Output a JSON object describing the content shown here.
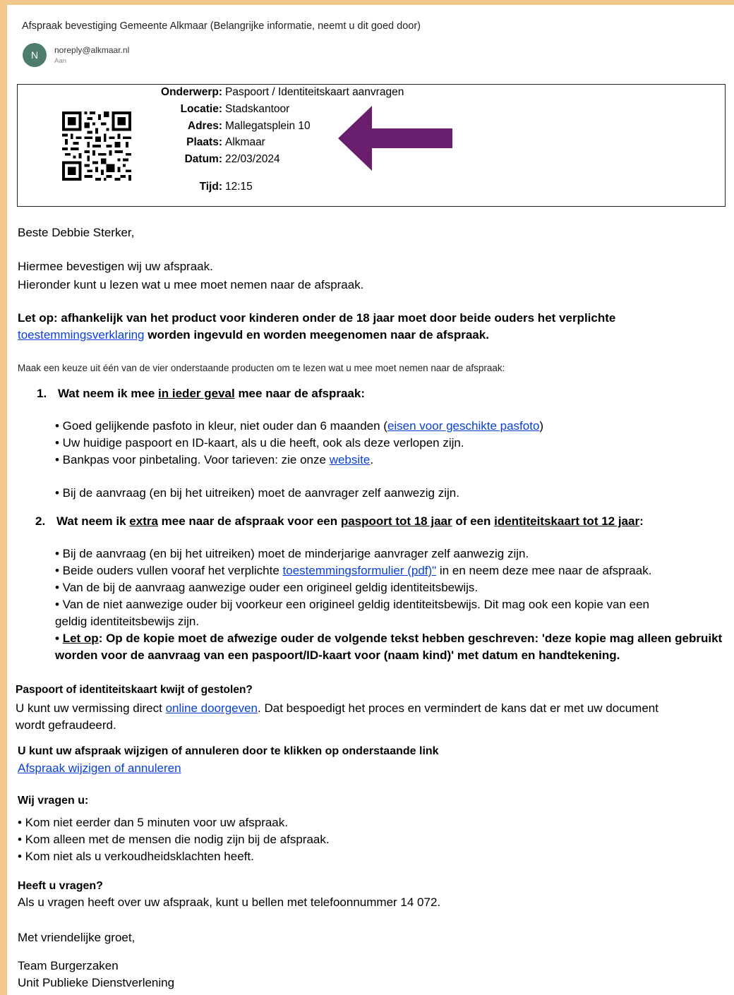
{
  "email": {
    "subject": "Afspraak bevestiging Gemeente Alkmaar (Belangrijke informatie, neemt u dit goed door)",
    "avatar_initial": "N",
    "sender": "noreply@alkmaar.nl",
    "recipient_label": "Aan"
  },
  "appointment": {
    "rows": [
      {
        "label": "Onderwerp:",
        "value": "Paspoort / Identiteitskaart aanvragen"
      },
      {
        "label": "Locatie:",
        "value": "Stadskantoor"
      },
      {
        "label": "Adres:",
        "value": "Mallegatsplein 10"
      },
      {
        "label": "Plaats:",
        "value": "Alkmaar"
      },
      {
        "label": "Datum:",
        "value": "22/03/2024"
      },
      {
        "label": "Tijd:",
        "value": "12:15"
      }
    ],
    "arrow_color": "#6a1f6e"
  },
  "body": {
    "greeting": "Beste Debbie Sterker,",
    "intro1": "Hiermee bevestigen wij uw afspraak.",
    "intro2": "Hieronder kunt u lezen wat u mee moet nemen naar de afspraak.",
    "notice_line1": "Let op: afhankelijk van het product voor kinderen onder de 18 jaar moet door beide ouders het verplichte",
    "notice_link": "toestemmingsverklaring",
    "notice_rest": " worden ingevuld en worden meegenomen naar de afspraak.",
    "choose_text": "Maak een keuze uit één van de vier onderstaande producten om te lezen wat u mee moet nemen naar de afspraak:",
    "s1": {
      "num": "1.",
      "head_a": "Wat neem ik mee ",
      "head_u": "in ieder geval",
      "head_b": " mee naar de afspraak:",
      "b1_pre": "• Goed gelijkende pasfoto in kleur, niet ouder dan 6 maanden (",
      "b1_link": "eisen voor geschikte pasfoto",
      "b1_post": ")",
      "b2": "• Uw huidige paspoort en ID-kaart, als u die heeft, ook als deze verlopen zijn.",
      "b3_pre": "• Bankpas voor pinbetaling. Voor tarieven: zie onze ",
      "b3_link": "website",
      "b3_post": ".",
      "b4": "• Bij de aanvraag (en bij het uitreiken) moet de aanvrager zelf aanwezig zijn."
    },
    "s2": {
      "num": "2.",
      "head_a": "Wat neem ik ",
      "head_u1": "extra",
      "head_b": " mee naar de afspraak voor een ",
      "head_u2": "paspoort tot 18 jaar",
      "head_c": " of een ",
      "head_u3": "identiteitskaart tot 12 jaar",
      "head_d": ":",
      "b1": "• Bij de aanvraag (en bij het uitreiken) moet de minderjarige aanvrager zelf aanwezig zijn.",
      "b2_pre": "• Beide ouders vullen vooraf het verplichte ",
      "b2_link": "toestemmingsformulier (pdf)\"",
      "b2_post": " in en neem deze mee naar de afspraak.",
      "b3": "• Van de bij de aanvraag aanwezige ouder een origineel geldig identiteitsbewijs.",
      "b4a": "• Van de niet aanwezige ouder bij voorkeur een origineel geldig identiteitsbewijs. Dit mag ook een kopie van een",
      "b4b": "geldig identiteitsbewijs zijn.",
      "b5_bullet": "• ",
      "b5_u": "Let op",
      "b5a": ": Op de kopie moet de afwezige ouder de volgende tekst hebben geschreven: 'deze kopie mag alleen gebruikt",
      "b5b": "worden voor de aanvraag van een paspoort/ID-kaart voor (naam kind)' met datum en handtekening."
    },
    "lost": {
      "heading": "Paspoort of identiteitskaart kwijt of gestolen?",
      "pre": "U kunt uw vermissing direct ",
      "link": "online doorgeven",
      "post": ". Dat bespoedigt het proces en vermindert de kans dat er met uw document",
      "line2": "wordt gefraudeerd."
    },
    "change": {
      "heading": "U kunt uw afspraak wijzigen of annuleren door te klikken op onderstaande link",
      "link": "Afspraak wijzigen of annuleren"
    },
    "ask": {
      "heading": "Wij vragen u:",
      "items": [
        "• Kom niet eerder dan 5 minuten voor uw afspraak.",
        "• Kom alleen met de mensen die nodig zijn bij de afspraak.",
        "• Kom niet als u verkoudheidsklachten heeft."
      ]
    },
    "questions": {
      "heading": "Heeft u vragen?",
      "text": "Als u vragen heeft over uw afspraak, kunt u bellen met telefoonnummer 14 072."
    },
    "closing": "Met vriendelijke groet,",
    "team": "Team Burgerzaken",
    "unit": "Unit Publieke Dienstverlening"
  }
}
